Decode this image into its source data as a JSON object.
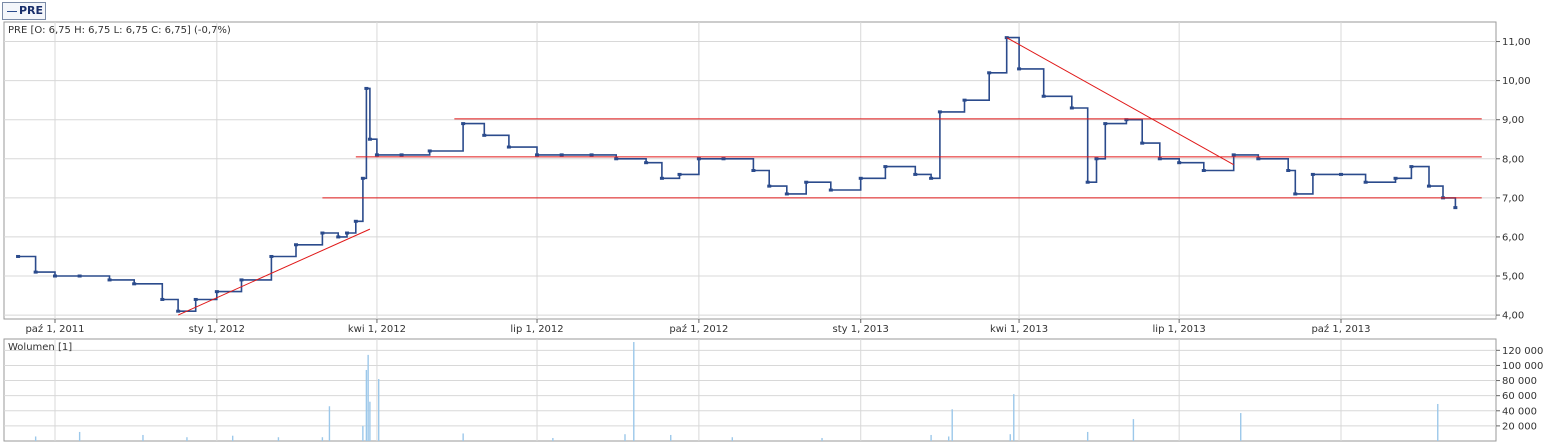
{
  "legend_tab": "PRE",
  "colors": {
    "price": "#2b4b8c",
    "volume": "#9cc8ea",
    "trend": "#e01818",
    "grid": "#d8d8d8",
    "frame": "#9a9a9a",
    "text": "#333333"
  },
  "chart_data": [
    {
      "type": "line",
      "title": "PRE [O: 6,75  H: 6,75  L: 6,75  C: 6,75] (-0,7%)",
      "xlabel": "",
      "ylabel": "",
      "ylim": [
        3.9,
        11.5
      ],
      "y_ticks": [
        "4,00",
        "5,00",
        "6,00",
        "7,00",
        "8,00",
        "9,00",
        "10,00",
        "11,00"
      ],
      "x_ticks": [
        "paź 1, 2011",
        "sty 1, 2012",
        "kwi 1, 2012",
        "lip 1, 2012",
        "paź 1, 2012",
        "sty 1, 2013",
        "kwi 1, 2013",
        "lip 1, 2013",
        "paź 1, 2013"
      ],
      "x_tick_dates": [
        "2011-10-01",
        "2012-01-01",
        "2012-04-01",
        "2012-07-01",
        "2012-10-01",
        "2013-01-01",
        "2013-04-01",
        "2013-07-01",
        "2013-10-01"
      ],
      "grid": true,
      "series": [
        {
          "name": "PRE",
          "x": [
            "2011-09-10",
            "2011-09-20",
            "2011-10-01",
            "2011-10-15",
            "2011-11-01",
            "2011-11-15",
            "2011-12-01",
            "2011-12-10",
            "2011-12-20",
            "2012-01-01",
            "2012-01-15",
            "2012-02-01",
            "2012-02-15",
            "2012-03-01",
            "2012-03-10",
            "2012-03-15",
            "2012-03-20",
            "2012-03-24",
            "2012-03-26",
            "2012-03-28",
            "2012-04-01",
            "2012-04-15",
            "2012-05-01",
            "2012-05-20",
            "2012-06-01",
            "2012-06-15",
            "2012-07-01",
            "2012-07-15",
            "2012-08-01",
            "2012-08-15",
            "2012-09-01",
            "2012-09-10",
            "2012-09-20",
            "2012-10-01",
            "2012-10-15",
            "2012-11-01",
            "2012-11-10",
            "2012-11-20",
            "2012-12-01",
            "2012-12-15",
            "2013-01-01",
            "2013-01-15",
            "2013-02-01",
            "2013-02-10",
            "2013-02-15",
            "2013-03-01",
            "2013-03-15",
            "2013-03-25",
            "2013-04-01",
            "2013-04-15",
            "2013-05-01",
            "2013-05-10",
            "2013-05-15",
            "2013-05-20",
            "2013-06-01",
            "2013-06-10",
            "2013-06-20",
            "2013-07-01",
            "2013-07-15",
            "2013-08-01",
            "2013-08-15",
            "2013-09-01",
            "2013-09-05",
            "2013-09-15",
            "2013-10-01",
            "2013-10-15",
            "2013-11-01",
            "2013-11-10",
            "2013-11-20",
            "2013-11-28",
            "2013-12-05"
          ],
          "y": [
            5.5,
            5.1,
            5.0,
            5.0,
            4.9,
            4.8,
            4.4,
            4.1,
            4.4,
            4.6,
            4.9,
            5.5,
            5.8,
            6.1,
            6.0,
            6.1,
            6.4,
            7.5,
            9.8,
            8.5,
            8.1,
            8.1,
            8.2,
            8.9,
            8.6,
            8.3,
            8.1,
            8.1,
            8.1,
            8.0,
            7.9,
            7.5,
            7.6,
            8.0,
            8.0,
            7.7,
            7.3,
            7.1,
            7.4,
            7.2,
            7.5,
            7.8,
            7.6,
            7.5,
            9.2,
            9.5,
            10.2,
            11.1,
            10.3,
            9.6,
            9.3,
            7.4,
            8.0,
            8.9,
            9.0,
            8.4,
            8.0,
            7.9,
            7.7,
            8.1,
            8.0,
            7.7,
            7.1,
            7.6,
            7.6,
            7.4,
            7.5,
            7.8,
            7.3,
            7.0,
            6.75
          ]
        }
      ],
      "trend_lines": [
        {
          "x": [
            "2011-12-10",
            "2012-03-28"
          ],
          "y": [
            4.0,
            6.2
          ]
        },
        {
          "x": [
            "2012-03-20",
            "2013-12-20"
          ],
          "y": [
            8.05,
            8.05
          ]
        },
        {
          "x": [
            "2012-05-15",
            "2013-12-20"
          ],
          "y": [
            9.02,
            9.02
          ]
        },
        {
          "x": [
            "2012-03-01",
            "2013-12-20"
          ],
          "y": [
            7.0,
            7.0
          ]
        },
        {
          "x": [
            "2013-03-25",
            "2013-08-01"
          ],
          "y": [
            11.1,
            7.85
          ]
        }
      ]
    },
    {
      "type": "bar",
      "title": "Wolumen [1]",
      "xlabel": "",
      "ylabel": "",
      "ylim": [
        0,
        135000
      ],
      "y_ticks": [
        "20 000",
        "40 000",
        "60 000",
        "80 000",
        "100 000",
        "120 000"
      ],
      "series": [
        {
          "name": "Wolumen",
          "x": [
            "2011-09-20",
            "2011-10-15",
            "2011-11-20",
            "2011-12-15",
            "2012-01-10",
            "2012-02-05",
            "2012-03-01",
            "2012-03-05",
            "2012-03-24",
            "2012-03-26",
            "2012-03-27",
            "2012-03-28",
            "2012-04-02",
            "2012-05-20",
            "2012-07-10",
            "2012-08-20",
            "2012-08-25",
            "2012-09-15",
            "2012-10-20",
            "2012-12-10",
            "2013-02-10",
            "2013-02-20",
            "2013-02-22",
            "2013-03-27",
            "2013-03-29",
            "2013-05-10",
            "2013-06-05",
            "2013-08-05",
            "2013-11-25"
          ],
          "y": [
            6000,
            12000,
            8000,
            5000,
            7000,
            5000,
            5000,
            46000,
            20000,
            94000,
            114000,
            52000,
            82000,
            10000,
            4000,
            9000,
            131000,
            8000,
            5000,
            4000,
            8000,
            6000,
            42000,
            9000,
            62000,
            12000,
            29000,
            37000,
            49000
          ]
        }
      ]
    }
  ]
}
